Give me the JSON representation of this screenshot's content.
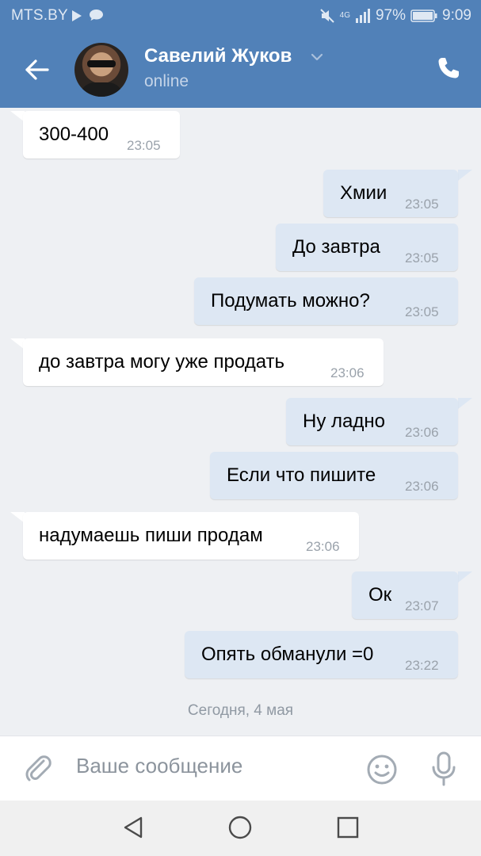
{
  "status_bar": {
    "carrier": "MTS.BY",
    "network": "4G",
    "battery": "97%",
    "time": "9:09"
  },
  "header": {
    "name": "Савелий Жуков",
    "status": "online"
  },
  "messages": [
    {
      "dir": "in",
      "text": "300-400",
      "time": "23:05"
    },
    {
      "dir": "out",
      "text": "Хмии",
      "time": "23:05"
    },
    {
      "dir": "out",
      "text": "До завтра",
      "time": "23:05"
    },
    {
      "dir": "out",
      "text": "Подумать можно?",
      "time": "23:05"
    },
    {
      "dir": "in",
      "text": "до завтра могу уже продать",
      "time": "23:06"
    },
    {
      "dir": "out",
      "text": "Ну ладно",
      "time": "23:06"
    },
    {
      "dir": "out",
      "text": "Если что пишите",
      "time": "23:06"
    },
    {
      "dir": "in",
      "text": "надумаешь пиши продам",
      "time": "23:06"
    },
    {
      "dir": "out",
      "text": "Ок",
      "time": "23:07"
    },
    {
      "dir": "out",
      "text": "Опять обманули =0",
      "time": "23:22"
    }
  ],
  "date_separator": "Сегодня, 4 мая",
  "composer": {
    "placeholder": "Ваше сообщение"
  },
  "colors": {
    "accent": "#5181b8",
    "incoming_bubble": "#ffffff",
    "outgoing_bubble": "#dde7f3",
    "chat_background": "#eef0f3"
  },
  "icons": [
    "back-arrow-icon",
    "chevron-down-icon",
    "phone-icon",
    "paperclip-icon",
    "smile-icon",
    "microphone-icon",
    "nav-back-icon",
    "nav-home-icon",
    "nav-recents-icon"
  ]
}
